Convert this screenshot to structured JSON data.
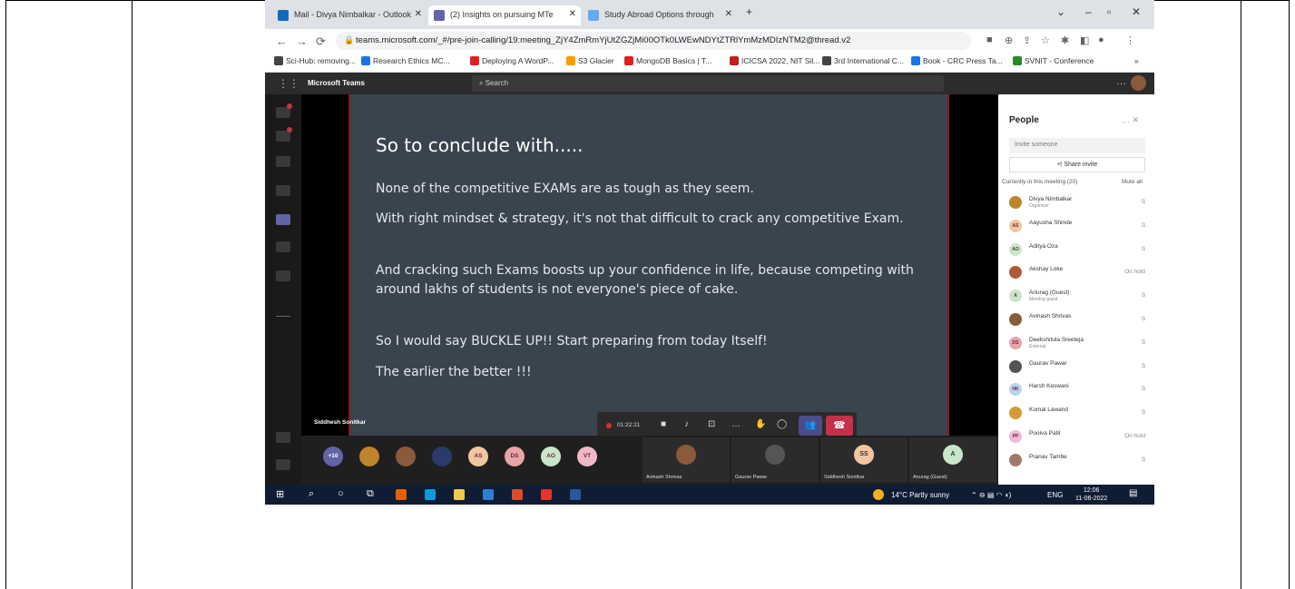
{
  "browser": {
    "tabs": [
      {
        "title": "Mail - Divya Nimbalkar - Outlook",
        "color": "#0f6cbd"
      },
      {
        "title": "(2) Insights on pursuing MTe",
        "color": "#6264a7"
      },
      {
        "title": "Study Abroad Options through",
        "color": "#66aaee"
      }
    ],
    "url": "teams.microsoft.com/_#/pre-join-calling/19:meeting_ZjY4ZmRmYjUtZGZjMi00OTk0LWEwNDYtZTRlYmMzMDIzNTM2@thread.v2",
    "bookmarks": [
      {
        "label": "Sci-Hub: removing...",
        "color": "#444"
      },
      {
        "label": "Research Ethics MC...",
        "color": "#1a73e8"
      },
      {
        "label": "Deploying A WordP...",
        "color": "#e02020"
      },
      {
        "label": "S3 Glacier",
        "color": "#ff9900"
      },
      {
        "label": "MongoDB Basics | T...",
        "color": "#e02020"
      },
      {
        "label": "ICICSA 2022, NIT Sil...",
        "color": "#c02020"
      },
      {
        "label": "3rd International C...",
        "color": "#444"
      },
      {
        "label": "Book - CRC Press Ta...",
        "color": "#1a73e8"
      },
      {
        "label": "SVNIT - Conference",
        "color": "#2a8a2a"
      }
    ],
    "more_bookmarks": "»"
  },
  "teams": {
    "brand": "Microsoft Teams",
    "search_placeholder": "Search",
    "presenter": "Siddhesh Sonitkar",
    "timer": "01:22:21",
    "overflow_count": "+10"
  },
  "slide": {
    "title": "So to conclude with.....",
    "points": [
      "None of the competitive EXAMs are as tough as they seem.",
      "With right mindset & strategy, it's not that difficult to crack any competitive Exam.",
      "And cracking such Exams boosts up your confidence in life, because competing with around lakhs of students is not everyone's piece of cake.",
      "So I would say BUCKLE UP!! Start preparing from today Itself!",
      "The earlier the better !!!"
    ]
  },
  "strip": {
    "avatars": [
      {
        "initials": "",
        "color": "#c0842a"
      },
      {
        "initials": "",
        "color": "#8a5a3c"
      },
      {
        "initials": "",
        "color": "#2a3a6a"
      },
      {
        "initials": "AS",
        "color": "#f2c6a0"
      },
      {
        "initials": "DS",
        "color": "#e8a4a8"
      },
      {
        "initials": "AO",
        "color": "#c8e6c9"
      },
      {
        "initials": "VT",
        "color": "#f2b8c6"
      }
    ],
    "tiles": [
      {
        "name": "Avinash Shrivas",
        "initials": "",
        "color": "#8a5a3c"
      },
      {
        "name": "Gaurav Pawar",
        "initials": "",
        "color": "#555"
      },
      {
        "name": "Siddhesh Sonitkar",
        "initials": "SS",
        "color": "#f2c6a0"
      },
      {
        "name": "Anurag (Guest)",
        "initials": "A",
        "color": "#c8e6c9"
      }
    ]
  },
  "people": {
    "header": "People",
    "invite_placeholder": "Invite someone",
    "share_invite": "Share invite",
    "current_label": "Currently in this meeting (20)",
    "mute_all": "Mute all",
    "participants": [
      {
        "name": "Divya Nimbalkar",
        "sub": "Organizer",
        "status": "",
        "initials": "",
        "color": "#c0842a"
      },
      {
        "name": "Aayusha Shinde",
        "sub": "",
        "status": "",
        "initials": "AS",
        "color": "#f2c6a0"
      },
      {
        "name": "Aditya Oza",
        "sub": "",
        "status": "",
        "initials": "AO",
        "color": "#c8e6c9"
      },
      {
        "name": "Akshay Lokе",
        "sub": "",
        "status": "On hold",
        "initials": "",
        "color": "#b05a3c"
      },
      {
        "name": "Anurag (Guest)",
        "sub": "Meeting guest",
        "status": "",
        "initials": "A",
        "color": "#c8e6c9"
      },
      {
        "name": "Avinash Shrivas",
        "sub": "",
        "status": "",
        "initials": "",
        "color": "#8a5a3c"
      },
      {
        "name": "Deekshitula Sreeteja",
        "sub": "External",
        "status": "",
        "initials": "DS",
        "color": "#e8a4a8"
      },
      {
        "name": "Gaurav Pawar",
        "sub": "",
        "status": "",
        "initials": "",
        "color": "#555"
      },
      {
        "name": "Harsh Keswani",
        "sub": "",
        "status": "",
        "initials": "HK",
        "color": "#bcd4f0"
      },
      {
        "name": "Komal Lawand",
        "sub": "",
        "status": "",
        "initials": "",
        "color": "#d49a3a"
      },
      {
        "name": "Pooiva Patil",
        "sub": "",
        "status": "On hold",
        "initials": "PP",
        "color": "#f2b8d8"
      },
      {
        "name": "Pranav Tambe",
        "sub": "",
        "status": "",
        "initials": "",
        "color": "#a07a6a"
      }
    ]
  },
  "taskbar": {
    "weather": "14°C  Partly sunny",
    "lang": "ENG",
    "time": "12:06",
    "date": "11-06-2022"
  }
}
